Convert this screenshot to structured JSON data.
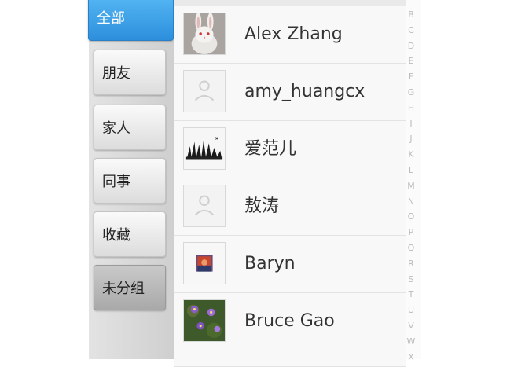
{
  "sidebar": {
    "tabs": [
      {
        "label": "全部",
        "state": "selected"
      },
      {
        "label": "朋友"
      },
      {
        "label": "家人"
      },
      {
        "label": "同事"
      },
      {
        "label": "收藏"
      },
      {
        "label": "未分组"
      }
    ]
  },
  "contacts": [
    {
      "name": "Alex Zhang",
      "avatar": "bunny-photo"
    },
    {
      "name": "amy_huangcx",
      "avatar": "default-person-icon"
    },
    {
      "name": "爱范儿",
      "avatar": "ink-sketch-image"
    },
    {
      "name": "敖涛",
      "avatar": "default-person-icon"
    },
    {
      "name": "Baryn",
      "avatar": "small-portrait-photo"
    },
    {
      "name": "Bruce Gao",
      "avatar": "purple-flowers-photo"
    }
  ],
  "index_letters": [
    "B",
    "C",
    "D",
    "E",
    "F",
    "G",
    "H",
    "I",
    "J",
    "K",
    "L",
    "M",
    "N",
    "O",
    "P",
    "Q",
    "R",
    "S",
    "T",
    "U",
    "V",
    "W",
    "X"
  ],
  "colors": {
    "active_tab": "#3a9de6",
    "sidebar_bg": "#d9d9d9",
    "list_bg": "#f8f8f8"
  }
}
